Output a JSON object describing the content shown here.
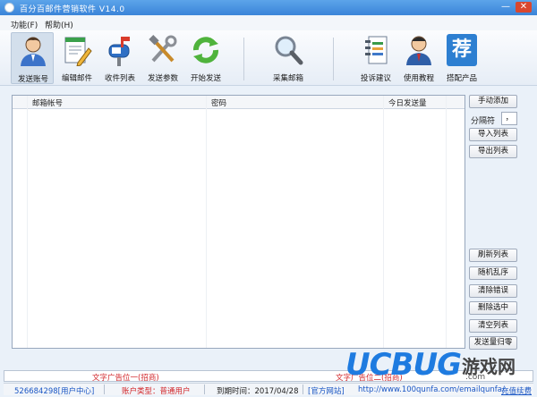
{
  "window": {
    "title": "百分百邮件营销软件    V14.0",
    "minimize_glyph": "—",
    "close_glyph": "✕"
  },
  "menu": [
    "功能(F)",
    "帮助(H)"
  ],
  "toolbar": {
    "items": [
      {
        "label": "发送账号",
        "icon": "user-avatar-icon",
        "active": true
      },
      {
        "label": "编辑邮件",
        "icon": "edit-document-icon"
      },
      {
        "label": "收件列表",
        "icon": "mailbox-icon"
      },
      {
        "label": "发送参数",
        "icon": "tools-icon"
      },
      {
        "label": "开始发送",
        "icon": "refresh-send-icon"
      },
      {
        "label": "采集邮箱",
        "icon": "magnifier-icon"
      },
      {
        "label": "投诉建议",
        "icon": "notebook-icon"
      },
      {
        "label": "使用教程",
        "icon": "tutor-icon"
      },
      {
        "label": "搭配产品",
        "icon": "recommend-icon",
        "glyph": "荐"
      }
    ]
  },
  "table": {
    "columns": [
      "邮箱帐号",
      "密码",
      "今日发送量"
    ],
    "rows": []
  },
  "sidebar": {
    "manual_add": "手动添加",
    "separator_label": "分隔符",
    "separator_value": "，",
    "import_list": "导入列表",
    "export_list": "导出列表",
    "refresh_list": "刷新列表",
    "shuffle": "随机乱序",
    "clear_errors": "清除错误",
    "delete_selected": "删除选中",
    "clear_list": "清空列表",
    "reset_count": "发送量归零"
  },
  "ads": {
    "left": "文字广告位一(招商)",
    "right": "文字广告位二(招商)"
  },
  "status": {
    "account": "526684298[用户中心]",
    "account_type": "账户类型：普通用户",
    "expire": "到期时间：2017/04/28",
    "site": "[官方网站]",
    "url": "http://www.100qunfa.com/emailqunfa/",
    "recharge": "充值续费"
  },
  "watermark": {
    "brand": "UCBUG",
    "cn": "游戏网",
    "domain": ".com"
  },
  "colors": {
    "titlebar": "#3a84d8",
    "ad_text": "#d2262a",
    "link": "#1a56c4",
    "watermark_blue": "#1e7be0"
  }
}
